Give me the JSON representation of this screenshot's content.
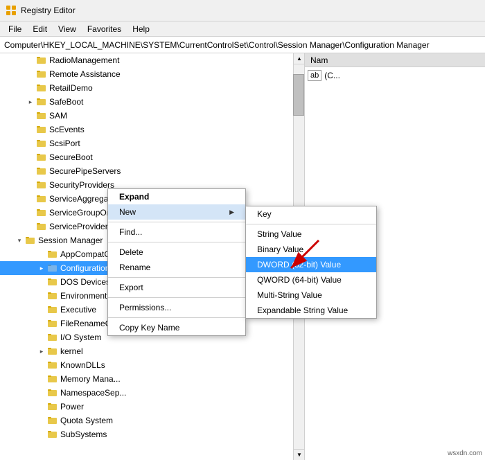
{
  "titleBar": {
    "title": "Registry Editor",
    "iconColor": "#e8a000"
  },
  "menuBar": {
    "items": [
      "File",
      "Edit",
      "View",
      "Favorites",
      "Help"
    ]
  },
  "addressBar": {
    "path": "Computer\\HKEY_LOCAL_MACHINE\\SYSTEM\\CurrentControlSet\\Control\\Session Manager\\Configuration Manager"
  },
  "treeItems": [
    {
      "id": "radiomanagement",
      "label": "RadioManagement",
      "indent": "indent-2",
      "expand": "none",
      "depth": 2
    },
    {
      "id": "remoteassistance",
      "label": "Remote Assistance",
      "indent": "indent-2",
      "expand": "none",
      "depth": 2
    },
    {
      "id": "retaildemo",
      "label": "RetailDemo",
      "indent": "indent-2",
      "expand": "none",
      "depth": 2
    },
    {
      "id": "safeboot",
      "label": "SafeBoot",
      "indent": "indent-2",
      "expand": "collapsed",
      "depth": 2
    },
    {
      "id": "sam",
      "label": "SAM",
      "indent": "indent-2",
      "expand": "none",
      "depth": 2
    },
    {
      "id": "scevents",
      "label": "ScEvents",
      "indent": "indent-2",
      "expand": "none",
      "depth": 2
    },
    {
      "id": "scsiport",
      "label": "ScsiPort",
      "indent": "indent-2",
      "expand": "none",
      "depth": 2
    },
    {
      "id": "secureboot",
      "label": "SecureBoot",
      "indent": "indent-2",
      "expand": "none",
      "depth": 2
    },
    {
      "id": "securepipeservers",
      "label": "SecurePipeServers",
      "indent": "indent-2",
      "expand": "none",
      "depth": 2
    },
    {
      "id": "securityproviders",
      "label": "SecurityProviders",
      "indent": "indent-2",
      "expand": "none",
      "depth": 2
    },
    {
      "id": "serviceaggregatedevents",
      "label": "ServiceAggregatedEvents",
      "indent": "indent-2",
      "expand": "none",
      "depth": 2
    },
    {
      "id": "servicegrouporder",
      "label": "ServiceGroupOrder",
      "indent": "indent-2",
      "expand": "none",
      "depth": 2
    },
    {
      "id": "serviceprovider",
      "label": "ServiceProvider",
      "indent": "indent-2",
      "expand": "none",
      "depth": 2
    },
    {
      "id": "sessionmanager",
      "label": "Session Manager",
      "indent": "indent-1",
      "expand": "expanded",
      "depth": 1
    },
    {
      "id": "appcompatcache",
      "label": "AppCompatCache",
      "indent": "indent-2",
      "expand": "none",
      "depth": 2
    },
    {
      "id": "configurationmanager",
      "label": "Configuration Manager",
      "indent": "indent-2",
      "expand": "collapsed",
      "depth": 2,
      "selected": true
    },
    {
      "id": "dosdevices",
      "label": "DOS Devices",
      "indent": "indent-2",
      "expand": "none",
      "depth": 2
    },
    {
      "id": "environment",
      "label": "Environment",
      "indent": "indent-2",
      "expand": "none",
      "depth": 2
    },
    {
      "id": "executive",
      "label": "Executive",
      "indent": "indent-2",
      "expand": "none",
      "depth": 2
    },
    {
      "id": "filerename",
      "label": "FileRenameOpe...",
      "indent": "indent-2",
      "expand": "none",
      "depth": 2
    },
    {
      "id": "iosystem",
      "label": "I/O System",
      "indent": "indent-2",
      "expand": "none",
      "depth": 2
    },
    {
      "id": "kernel",
      "label": "kernel",
      "indent": "indent-2",
      "expand": "collapsed",
      "depth": 2
    },
    {
      "id": "knowndlls",
      "label": "KnownDLLs",
      "indent": "indent-2",
      "expand": "none",
      "depth": 2
    },
    {
      "id": "memorymana",
      "label": "Memory Mana...",
      "indent": "indent-2",
      "expand": "none",
      "depth": 2
    },
    {
      "id": "namespacesep",
      "label": "NamespaceSep...",
      "indent": "indent-2",
      "expand": "none",
      "depth": 2
    },
    {
      "id": "power",
      "label": "Power",
      "indent": "indent-2",
      "expand": "none",
      "depth": 2
    },
    {
      "id": "quotasystem",
      "label": "Quota System",
      "indent": "indent-2",
      "expand": "none",
      "depth": 2
    },
    {
      "id": "subsystems",
      "label": "SubSystems",
      "indent": "indent-2",
      "expand": "none",
      "depth": 2
    }
  ],
  "rightPanel": {
    "columns": [
      "Name",
      ""
    ],
    "abIcon": "ab"
  },
  "contextMenu": {
    "items": [
      {
        "id": "expand",
        "label": "Expand",
        "bold": true
      },
      {
        "id": "new",
        "label": "New",
        "hasSubmenu": true
      },
      {
        "id": "find",
        "label": "Find..."
      },
      {
        "id": "delete",
        "label": "Delete"
      },
      {
        "id": "rename",
        "label": "Rename"
      },
      {
        "id": "export",
        "label": "Export"
      },
      {
        "id": "permissions",
        "label": "Permissions..."
      },
      {
        "id": "copykeyname",
        "label": "Copy Key Name"
      }
    ]
  },
  "submenu": {
    "items": [
      {
        "id": "key",
        "label": "Key"
      },
      {
        "id": "stringvalue",
        "label": "String Value"
      },
      {
        "id": "binaryvalue",
        "label": "Binary Value"
      },
      {
        "id": "dwordvalue",
        "label": "DWORD (32-bit) Value",
        "selected": true
      },
      {
        "id": "qwordvalue",
        "label": "QWORD (64-bit) Value"
      },
      {
        "id": "multistringvalue",
        "label": "Multi-String Value"
      },
      {
        "id": "expandablestringvalue",
        "label": "Expandable String Value"
      }
    ]
  },
  "watermark": "wsxdn.com"
}
